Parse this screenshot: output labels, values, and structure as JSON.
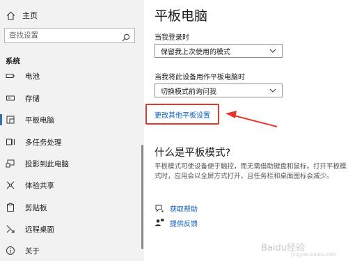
{
  "sidebar": {
    "home_label": "主页",
    "search_placeholder": "查找设置",
    "section_title": "系统",
    "items": [
      {
        "label": "电池",
        "icon": "battery-icon"
      },
      {
        "label": "存储",
        "icon": "storage-icon"
      },
      {
        "label": "平板电脑",
        "icon": "tablet-icon",
        "active": true
      },
      {
        "label": "多任务处理",
        "icon": "multitasking-icon"
      },
      {
        "label": "投影到此电脑",
        "icon": "projecting-icon"
      },
      {
        "label": "体验共享",
        "icon": "shared-experiences-icon"
      },
      {
        "label": "剪贴板",
        "icon": "clipboard-icon"
      },
      {
        "label": "远程桌面",
        "icon": "remote-desktop-icon"
      },
      {
        "label": "关于",
        "icon": "info-icon"
      }
    ]
  },
  "main": {
    "title": "平板电脑",
    "signin_label": "当我登录时",
    "signin_value": "保留我上次使用的模式",
    "tablet_label": "当我将此设备用作平板电脑时",
    "tablet_value": "切换模式前询问我",
    "more_settings_link": "更改其他平板设置",
    "what_is_title": "什么是平板模式?",
    "description": "平板模式可使设备便于触控，而无需借助键盘和鼠标。打开平板模式时，应用会以全屏方式打开，且任务栏和桌面图标会减少。",
    "help_link": "获取帮助",
    "feedback_link": "提供反馈"
  },
  "watermark": {
    "text": "Baidu经验",
    "sub": "jingyan.baidu.com"
  },
  "colors": {
    "accent": "#0b5fbf",
    "highlight": "#e8342c",
    "sidebar_bg": "#f2f2f2"
  }
}
